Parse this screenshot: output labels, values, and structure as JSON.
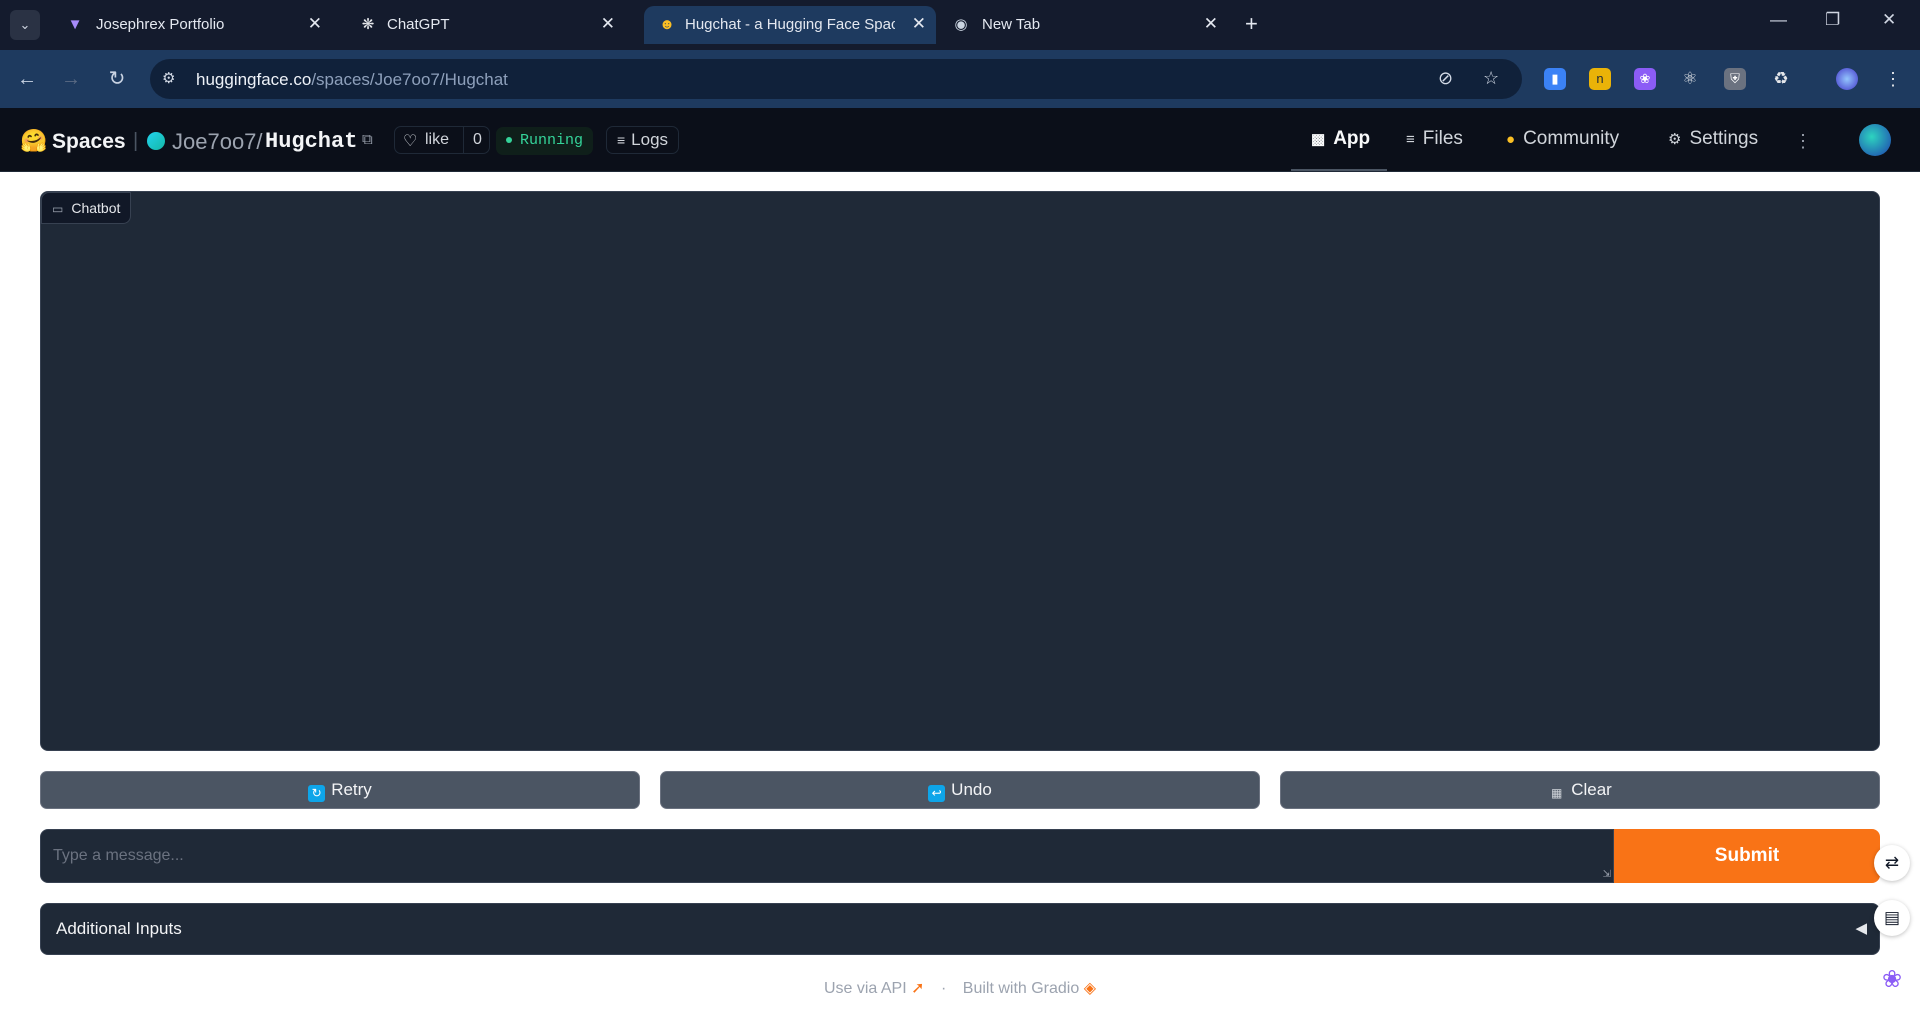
{
  "browser": {
    "tabs": [
      {
        "title": "Josephrex Portfolio",
        "icon": "vite-logo-icon"
      },
      {
        "title": "ChatGPT",
        "icon": "openai-logo-icon"
      },
      {
        "title": "Hugchat - a Hugging Face Space",
        "icon": "hugging-face-logo-icon"
      },
      {
        "title": "New Tab",
        "icon": "chrome-logo-icon"
      }
    ],
    "active_tab": 2,
    "url_host": "huggingface.co",
    "url_path": "/spaces/Joe7oo7/Hugchat"
  },
  "hf_header": {
    "brand": "Spaces",
    "owner": "Joe7oo7",
    "separator": "/",
    "repo": "Hugchat",
    "like_label": "like",
    "like_count": "0",
    "status": "Running",
    "logs_label": "Logs",
    "nav": [
      {
        "label": "App",
        "icon": "app-cube-icon"
      },
      {
        "label": "Files",
        "icon": "files-icon"
      },
      {
        "label": "Community",
        "icon": "community-icon"
      },
      {
        "label": "Settings",
        "icon": "settings-gear-icon"
      }
    ]
  },
  "app": {
    "chatbot_label": "Chatbot",
    "buttons": {
      "retry": "Retry",
      "undo": "Undo",
      "clear": "Clear"
    },
    "message_placeholder": "Type a message...",
    "submit_label": "Submit",
    "accordion_label": "Additional Inputs",
    "accent_color": "#f97316"
  },
  "footer": {
    "api_label": "Use via API",
    "separator": "·",
    "built_with": "Built with Gradio"
  }
}
